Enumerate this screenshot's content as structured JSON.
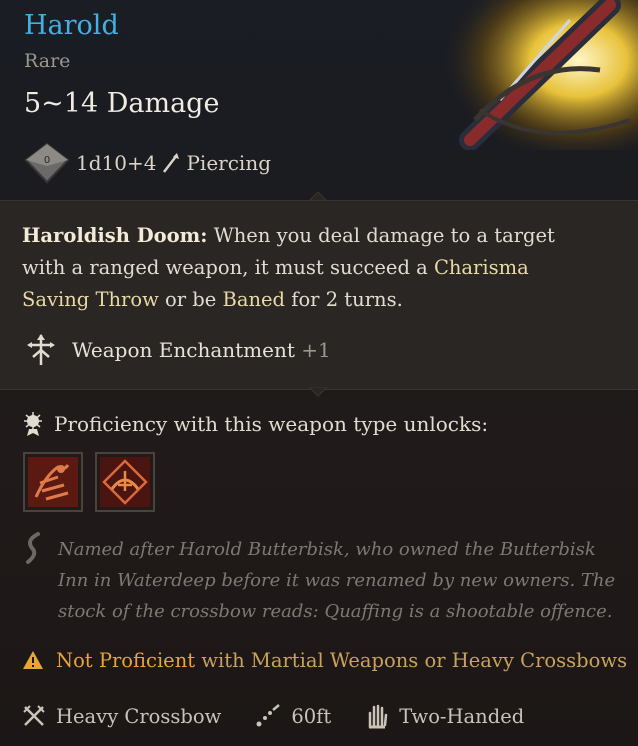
{
  "item": {
    "name": "Harold",
    "rarity": "Rare",
    "damage": "5~14 Damage",
    "dice": "1d10+4",
    "damage_type": "Piercing"
  },
  "effect": {
    "name": "Haroldish Doom:",
    "text_part1": " When you deal damage to a target with a ranged weapon, it must succeed a ",
    "link1": "Charisma Saving Throw",
    "text_part2": " or be ",
    "link2": "Baned",
    "text_part3": " for 2 turns."
  },
  "enchantment": {
    "label": "Weapon Enchantment",
    "value": "+1"
  },
  "proficiency": {
    "label": "Proficiency with this weapon type unlocks:",
    "actions": [
      "action-icon-1",
      "action-icon-2"
    ]
  },
  "lore": "Named after Harold Butterbisk, who owned the Butterbisk Inn in Waterdeep before it was renamed by new owners. The stock of the crossbow reads: Quaffing is a shootable offence.",
  "warning": {
    "not_proficient": "Not Proficient",
    "rest": "with Martial Weapons or Heavy Crossbows"
  },
  "footer": {
    "weapon_type": "Heavy Crossbow",
    "range": "60ft",
    "handedness": "Two-Handed"
  },
  "colors": {
    "title": "#3fb2e3",
    "warning": "#e9a43a"
  }
}
